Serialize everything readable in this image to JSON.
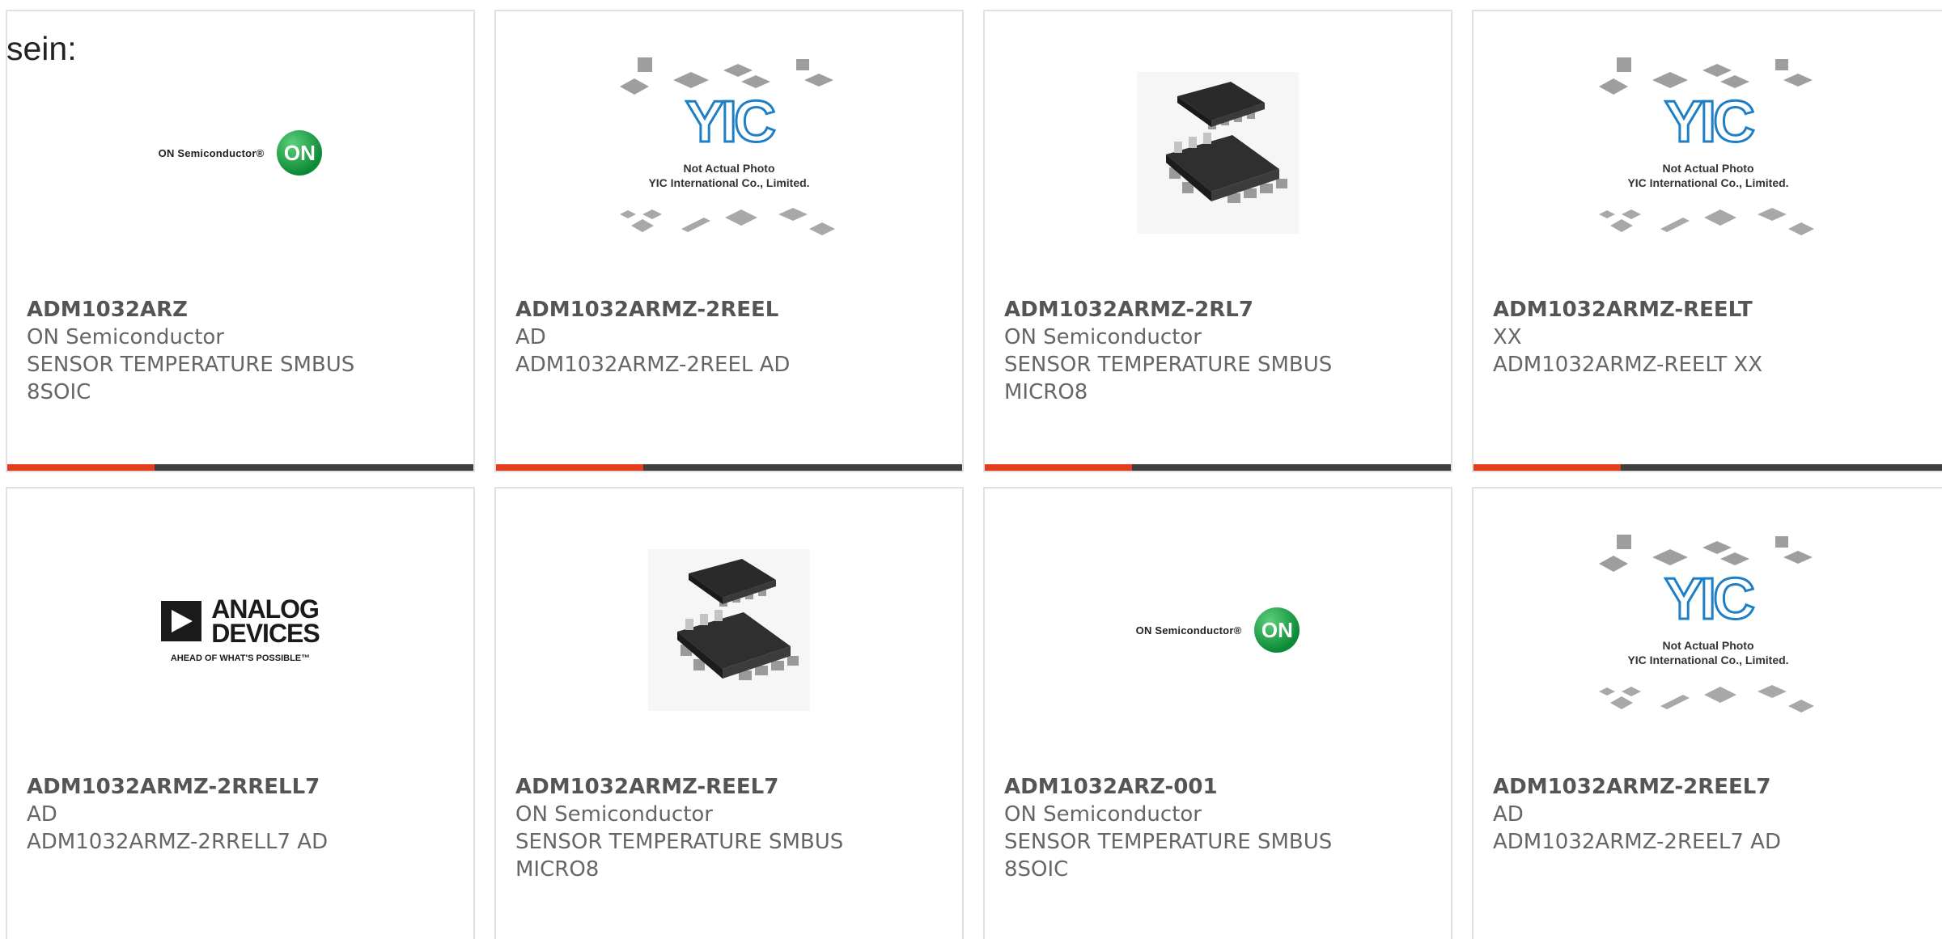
{
  "intro": "sein:",
  "yic_placeholder": {
    "brand": "YIC",
    "line1": "Not Actual Photo",
    "line2": "YIC International Co., Limited."
  },
  "logos": {
    "on": {
      "text": "ON Semiconductor®",
      "mark": "ON"
    },
    "adi": {
      "line1": "ANALOG",
      "line2": "DEVICES",
      "tagline": "AHEAD OF WHAT'S POSSIBLE™"
    }
  },
  "colors": {
    "accent": "#e63c1e",
    "accent_dark": "#3f3f3f",
    "card_border": "#e1e1e1",
    "yic_blue": "#1e7fc6",
    "on_green": "#0d8a37"
  },
  "products": [
    {
      "part": "ADM1032ARZ",
      "manufacturer": "ON Semiconductor",
      "description": "SENSOR TEMPERATURE SMBUS\n8SOIC",
      "image": "on-semiconductor-logo"
    },
    {
      "part": "ADM1032ARMZ-2REEL",
      "manufacturer": "AD",
      "description": "ADM1032ARMZ-2REEL AD",
      "image": "yic-placeholder"
    },
    {
      "part": "ADM1032ARMZ-2RL7",
      "manufacturer": "ON Semiconductor",
      "description": "SENSOR TEMPERATURE SMBUS\nMICRO8",
      "image": "micro8-chip"
    },
    {
      "part": "ADM1032ARMZ-REELT",
      "manufacturer": "XX",
      "description": "ADM1032ARMZ-REELT XX",
      "image": "yic-placeholder"
    },
    {
      "part": "ADM1032ARMZ-2RRELL7",
      "manufacturer": "AD",
      "description": "ADM1032ARMZ-2RRELL7 AD",
      "image": "analog-devices-logo"
    },
    {
      "part": "ADM1032ARMZ-REEL7",
      "manufacturer": "ON Semiconductor",
      "description": "SENSOR TEMPERATURE SMBUS\nMICRO8",
      "image": "micro8-chip"
    },
    {
      "part": "ADM1032ARZ-001",
      "manufacturer": "ON Semiconductor",
      "description": "SENSOR TEMPERATURE SMBUS\n8SOIC",
      "image": "on-semiconductor-logo"
    },
    {
      "part": "ADM1032ARMZ-2REEL7",
      "manufacturer": "AD",
      "description": "ADM1032ARMZ-2REEL7 AD",
      "image": "yic-placeholder"
    }
  ]
}
